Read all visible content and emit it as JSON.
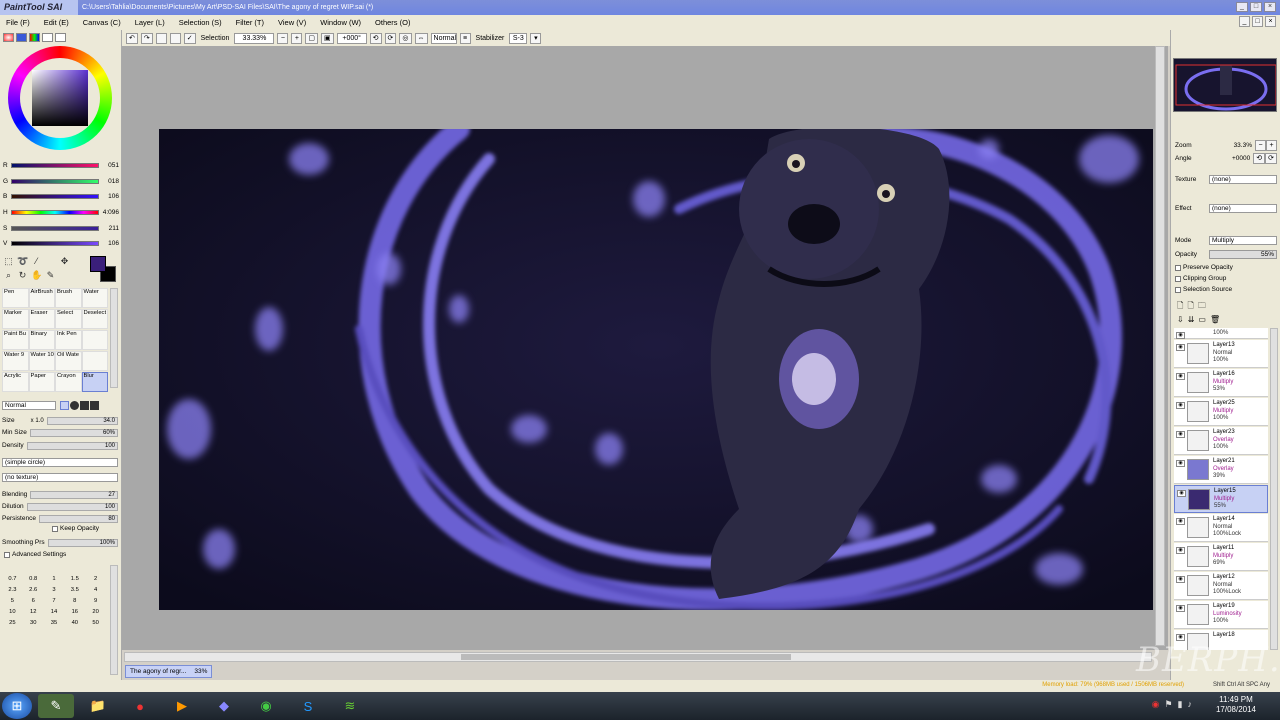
{
  "window": {
    "app_logo": "PaintTool SAI",
    "title": "C:\\Users\\Tahlia\\Documents\\Pictures\\My Art\\PSD-SAI Files\\SAI\\The agony of regret WIP.sai (*)"
  },
  "menu": [
    "File (F)",
    "Edit (E)",
    "Canvas (C)",
    "Layer (L)",
    "Selection (S)",
    "Filter (T)",
    "View (V)",
    "Window (W)",
    "Others (O)"
  ],
  "toolbar": {
    "selection_label": "Selection",
    "zoom": "33.33%",
    "angle": "+000°",
    "mode": "Normal",
    "stabilizer_label": "Stabilizer",
    "stabilizer_value": "S-3"
  },
  "color": {
    "r_label": "R",
    "r": "051",
    "g_label": "G",
    "g": "018",
    "b_label": "B",
    "b": "106",
    "h_label": "H",
    "h": "4:096",
    "s_label": "S",
    "s": "211",
    "v_label": "V",
    "v": "106",
    "foreground": "#3a1f7a",
    "background": "#000000"
  },
  "brushes": [
    {
      "name": "Pen"
    },
    {
      "name": "AirBrush"
    },
    {
      "name": "Brush"
    },
    {
      "name": "Water"
    },
    {
      "name": "Marker"
    },
    {
      "name": "Eraser"
    },
    {
      "name": "Select"
    },
    {
      "name": "Deselect"
    },
    {
      "name": "Paint Bu"
    },
    {
      "name": "Binary"
    },
    {
      "name": "Ink Pen"
    },
    {
      "name": ""
    },
    {
      "name": "Water 9"
    },
    {
      "name": "Water 10"
    },
    {
      "name": "Oil Wate 7"
    },
    {
      "name": ""
    },
    {
      "name": "Acrylic"
    },
    {
      "name": "Paper"
    },
    {
      "name": "Crayon"
    },
    {
      "name": "Blur"
    }
  ],
  "brush_props": {
    "blend_mode": "Normal",
    "size_label": "Size",
    "size_mult": "x 1.0",
    "size_value": "34.0",
    "min_size_label": "Min Size",
    "min_size": "60%",
    "density_label": "Density",
    "density": "100",
    "shape": "(simple circle)",
    "texture": "(no texture)",
    "blending_label": "Blending",
    "blending": "27",
    "dilution_label": "Dilution",
    "dilution": "100",
    "persistence_label": "Persistence",
    "persistence": "80",
    "keep_opacity_label": "Keep Opacity",
    "smoothing_label": "Smoothing Prs",
    "smoothing": "100%",
    "advanced_label": "Advanced Settings"
  },
  "brush_sizes": [
    "0.7",
    "0.8",
    "1",
    "1.5",
    "2",
    "2.3",
    "2.6",
    "3",
    "3.5",
    "4",
    "5",
    "6",
    "7",
    "8",
    "9",
    "10",
    "12",
    "14",
    "16",
    "20",
    "25",
    "30",
    "35",
    "40",
    "50"
  ],
  "document_tab": {
    "name": "The agony of regr...",
    "zoom": "33%"
  },
  "navigator": {
    "zoom_label": "Zoom",
    "zoom": "33.3%",
    "angle_label": "Angle",
    "angle": "+0000"
  },
  "layer_props": {
    "texture_label": "Texture",
    "texture": "(none)",
    "effect_label": "Effect",
    "effect": "(none)",
    "mode_label": "Mode",
    "mode": "Multiply",
    "opacity_label": "Opacity",
    "opacity": "55%",
    "preserve_opacity": "Preserve Opacity",
    "clipping_group": "Clipping Group",
    "selection_source": "Selection Source"
  },
  "layers": [
    {
      "name": "",
      "mode": "",
      "opacity": "100%"
    },
    {
      "name": "Layer13",
      "mode": "Normal",
      "opacity": "100%"
    },
    {
      "name": "Layer16",
      "mode": "Multiply",
      "opacity": "53%"
    },
    {
      "name": "Layer25",
      "mode": "Multiply",
      "opacity": "100%"
    },
    {
      "name": "Layer23",
      "mode": "Overlay",
      "opacity": "100%"
    },
    {
      "name": "Layer21",
      "mode": "Overlay",
      "opacity": "39%"
    },
    {
      "name": "Layer15",
      "mode": "Multiply",
      "opacity": "55%"
    },
    {
      "name": "Layer14",
      "mode": "Normal",
      "opacity": "100%Lock"
    },
    {
      "name": "Layer11",
      "mode": "Multiply",
      "opacity": "69%"
    },
    {
      "name": "Layer12",
      "mode": "Normal",
      "opacity": "100%Lock"
    },
    {
      "name": "Layer19",
      "mode": "Luminosity",
      "opacity": "100%"
    },
    {
      "name": "Layer18",
      "mode": "",
      "opacity": ""
    }
  ],
  "status": {
    "memory": "Memory load: 79% (968MB used / 1506MB reserved)",
    "keys": "Shift Ctrl Alt SPC Any"
  },
  "taskbar": {
    "time": "11:49 PM",
    "date": "17/08/2014"
  },
  "watermark": "BERPH."
}
